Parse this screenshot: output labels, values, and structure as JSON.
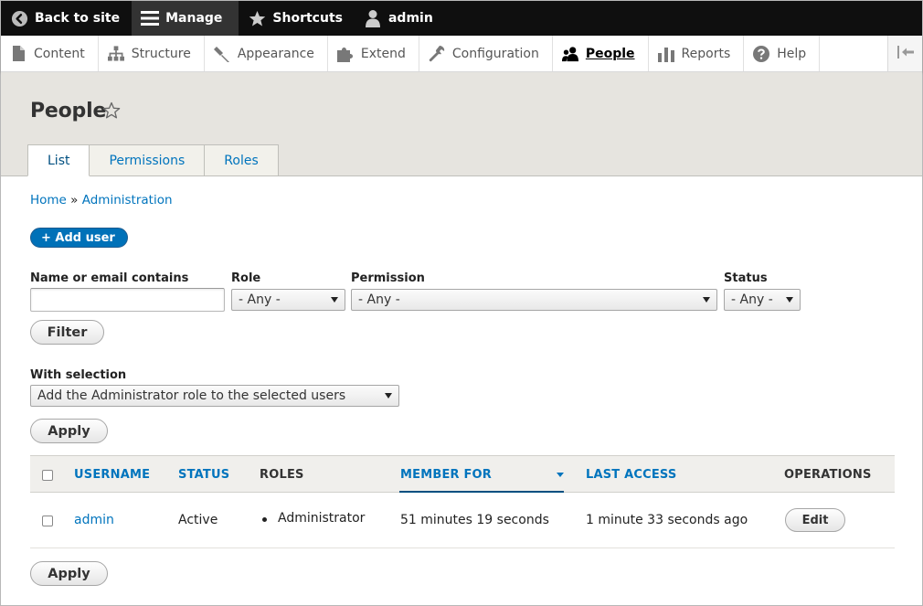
{
  "toolbar": {
    "back_to_site": "Back to site",
    "manage": "Manage",
    "shortcuts": "Shortcuts",
    "user": "admin"
  },
  "tray": {
    "items": [
      "Content",
      "Structure",
      "Appearance",
      "Extend",
      "Configuration",
      "People",
      "Reports",
      "Help"
    ],
    "active": "People"
  },
  "page": {
    "title": "People",
    "tabs": [
      "List",
      "Permissions",
      "Roles"
    ],
    "active_tab": "List"
  },
  "breadcrumb": {
    "home": "Home",
    "separator": "»",
    "administration": "Administration"
  },
  "add_user_label": "+ Add user",
  "filters": {
    "name_label": "Name or email contains",
    "name_value": "",
    "role_label": "Role",
    "role_value": "- Any -",
    "permission_label": "Permission",
    "permission_value": "- Any -",
    "status_label": "Status",
    "status_value": "- Any -",
    "filter_button": "Filter"
  },
  "bulk": {
    "label": "With selection",
    "action_value": "Add the Administrator role to the selected users",
    "apply_button": "Apply"
  },
  "table": {
    "headers": {
      "username": "USERNAME",
      "status": "STATUS",
      "roles": "ROLES",
      "member_for": "MEMBER FOR",
      "last_access": "LAST ACCESS",
      "operations": "OPERATIONS"
    },
    "sorted_by": "MEMBER FOR",
    "rows": [
      {
        "username": "admin",
        "status": "Active",
        "roles": "Administrator",
        "member_for": "51 minutes 19 seconds",
        "last_access": "1 minute 33 seconds ago",
        "operation": "Edit"
      }
    ]
  },
  "bottom_apply": "Apply",
  "colors": {
    "link": "#0074bd",
    "primary_button": "#0071b8",
    "toolbar_bg": "#0f0f0f",
    "header_bg": "#e6e4df"
  }
}
